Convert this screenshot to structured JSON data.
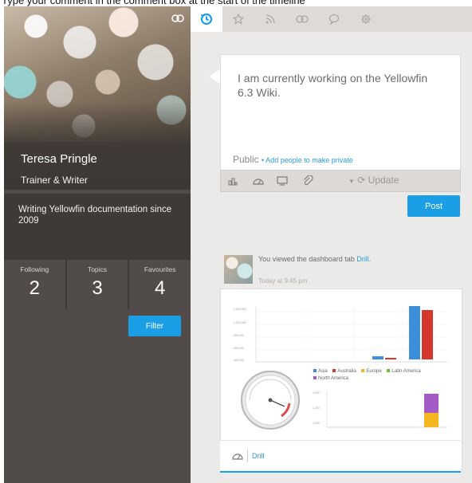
{
  "caption": "Type your comment in the comment box at the start of the timeline",
  "profile": {
    "name": "Teresa Pringle",
    "role": "Trainer & Writer",
    "bio": "Writing Yellowfin documentation since 2009",
    "stats": [
      {
        "label": "Following",
        "value": "2"
      },
      {
        "label": "Topics",
        "value": "3"
      },
      {
        "label": "Favourites",
        "value": "4"
      }
    ],
    "filter_label": "Filter"
  },
  "tabs": [
    {
      "icon": "timeline-icon",
      "active": true
    },
    {
      "icon": "star-icon",
      "active": false
    },
    {
      "icon": "rss-icon",
      "active": false
    },
    {
      "icon": "link-icon",
      "active": false
    },
    {
      "icon": "comment-icon",
      "active": false
    },
    {
      "icon": "gear-icon",
      "active": false
    }
  ],
  "composer": {
    "text": "I am currently working on the Yellowfin 6.3 Wiki.",
    "visibility": "Public",
    "add_people": "• Add people to make private",
    "update_label": "Update",
    "post_label": "Post"
  },
  "activity": {
    "prefix": "You viewed the dashboard tab",
    "link": "Drill.",
    "time": "Today at 9:45 pm",
    "drill_label": "Drill"
  },
  "dashboard": {
    "legend": [
      "Asia",
      "Australia",
      "Europe",
      "Latin America",
      "North America"
    ],
    "legend_colors": [
      "#3d8ed8",
      "#d4382c",
      "#f4b51f",
      "#76bd3a",
      "#a35bc6"
    ],
    "y_ticks_top": [
      "1,500,000",
      "1,200,000",
      "900,000",
      "600,000",
      "300,000"
    ],
    "y_ticks_small": [
      "1,500",
      "1,200",
      "1,000"
    ]
  }
}
